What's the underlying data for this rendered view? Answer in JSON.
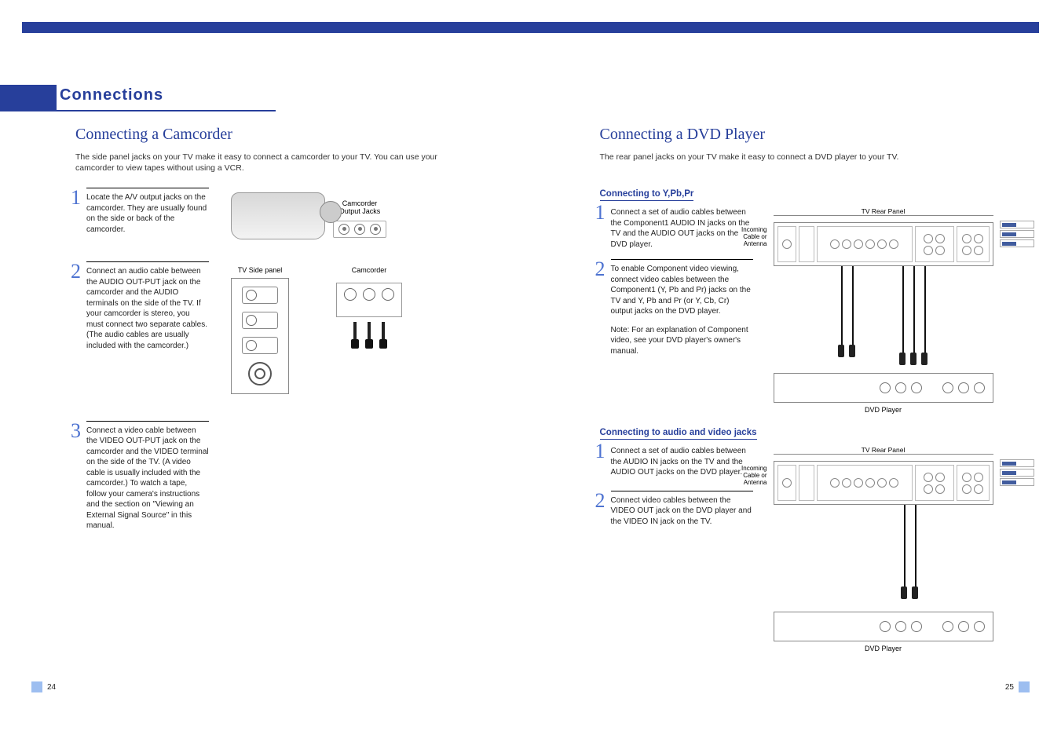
{
  "chapter": "Connections",
  "left": {
    "title": "Connecting a Camcorder",
    "intro": "The side panel jacks on your TV make it easy to connect a camcorder to your TV. You can use your camcorder to view tapes without using a VCR.",
    "steps": [
      "Locate the A/V output jacks on the camcorder. They are usually found on the side or back of the camcorder.",
      "Connect an audio cable between the AUDIO OUT-PUT jack on the camcorder and the AUDIO terminals on the side of the TV. If your camcorder is stereo, you must connect two separate cables. (The audio cables are usually included with the camcorder.)",
      "Connect a video cable between the VIDEO OUT-PUT jack on the camcorder and the VIDEO terminal on the side of the TV. (A video cable is usually included with the camcorder.) To watch a tape, follow your camera's instructions and the section on \"Viewing an External Signal Source\" in this manual."
    ],
    "illus": {
      "camcorder_jacks_label": "Camcorder\nOutput Jacks",
      "tv_side_label": "TV Side panel",
      "camcorder_label": "Camcorder"
    }
  },
  "right": {
    "title": "Connecting a DVD Player",
    "intro": "The rear panel jacks on your TV make it easy to connect a DVD player to your TV.",
    "sectionA": {
      "heading": "Connecting to Y,Pb,Pr",
      "steps": [
        "Connect a set of audio cables between the Component1 AUDIO IN jacks on the TV and the AUDIO OUT jacks on the DVD player.",
        "To enable Component video viewing, connect video cables between the Component1 (Y, Pb and Pr) jacks on the TV and Y, Pb and Pr (or Y, Cb, Cr) output jacks on the DVD player."
      ],
      "note": "Note: For an explanation of Component video, see your DVD player's owner's manual."
    },
    "sectionB": {
      "heading": "Connecting to audio and video jacks",
      "steps": [
        "Connect a set of audio cables between the AUDIO IN jacks on the TV and the AUDIO OUT jacks on the DVD player.",
        "Connect video cables between the VIDEO OUT jack on the DVD player and the VIDEO IN jack on the TV."
      ]
    },
    "illus": {
      "rear_label": "TV Rear Panel",
      "incoming_label": "Incoming\nCable or\nAntenna",
      "dvd_label": "DVD Player"
    }
  },
  "page_left": "24",
  "page_right": "25"
}
